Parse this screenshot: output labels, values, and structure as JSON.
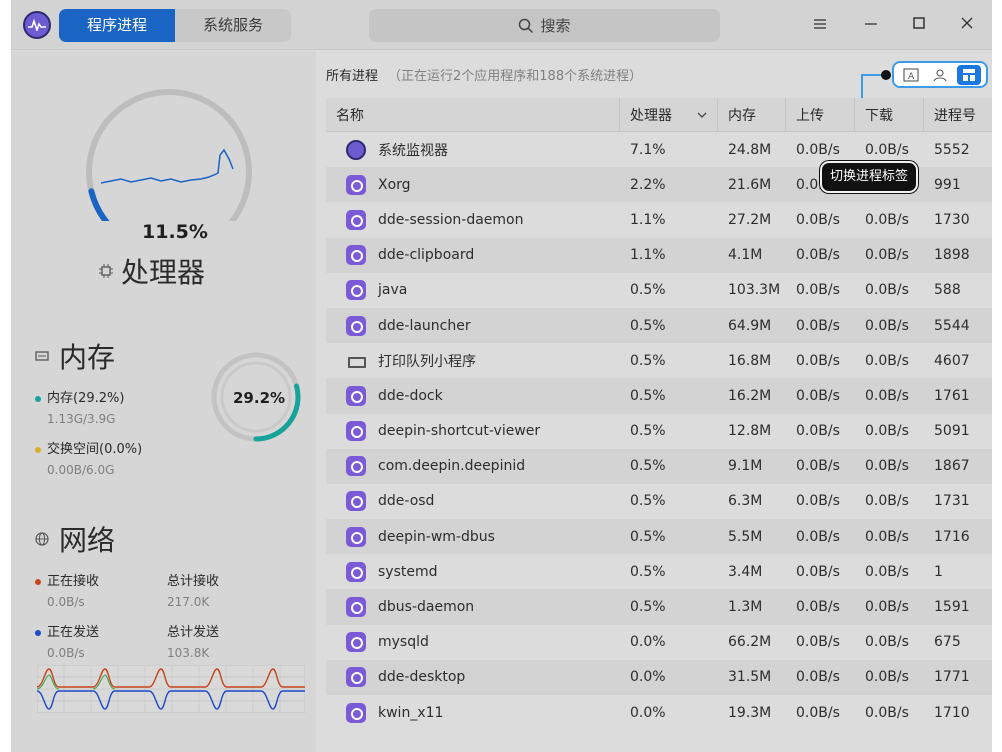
{
  "titlebar": {
    "tabs": [
      {
        "label": "程序进程",
        "active": true
      },
      {
        "label": "系统服务",
        "active": false
      }
    ],
    "search_label": "搜索",
    "icons": [
      "menu-icon",
      "minimize-icon",
      "maximize-icon",
      "close-icon"
    ]
  },
  "cpu": {
    "percent": "11.5%",
    "title": "处理器",
    "gauge_fraction": 0.115
  },
  "memory": {
    "title": "内存",
    "percent": "29.2%",
    "ring_fraction": 0.292,
    "legend": [
      {
        "label": "内存(29.2%)",
        "detail": "1.13G/3.9G",
        "color": "#16a39a"
      },
      {
        "label": "交换空间(0.0%)",
        "detail": "0.00B/6.0G",
        "color": "#d7b02a"
      }
    ]
  },
  "network": {
    "title": "网络",
    "items": [
      {
        "label": "正在接收",
        "value": "0.0B/s",
        "color": "#c8441c"
      },
      {
        "label": "总计接收",
        "value": "217.0K"
      },
      {
        "label": "正在发送",
        "value": "0.0B/s",
        "color": "#1c49c8"
      },
      {
        "label": "总计发送",
        "value": "103.8K"
      }
    ]
  },
  "processes": {
    "header": "所有进程",
    "subheader": "（正在运行2个应用程序和188个系统进程）",
    "tooltip": "切换进程标签",
    "view_buttons": [
      "app-view-icon",
      "user-view-icon",
      "all-view-icon"
    ],
    "columns": [
      "名称",
      "处理器",
      "内存",
      "上传",
      "下载",
      "进程号"
    ],
    "rows": [
      {
        "icon": "monitor",
        "name": "系统监视器",
        "cpu": "7.1%",
        "mem": "24.8M",
        "up": "0.0B/s",
        "down": "0.0B/s",
        "pid": "5552"
      },
      {
        "icon": "app",
        "name": "Xorg",
        "cpu": "2.2%",
        "mem": "21.6M",
        "up": "0.0B/s",
        "down": "0.0B/s",
        "pid": "991"
      },
      {
        "icon": "app",
        "name": "dde-session-daemon",
        "cpu": "1.1%",
        "mem": "27.2M",
        "up": "0.0B/s",
        "down": "0.0B/s",
        "pid": "1730"
      },
      {
        "icon": "app",
        "name": "dde-clipboard",
        "cpu": "1.1%",
        "mem": "4.1M",
        "up": "0.0B/s",
        "down": "0.0B/s",
        "pid": "1898"
      },
      {
        "icon": "app",
        "name": "java",
        "cpu": "0.5%",
        "mem": "103.3M",
        "up": "0.0B/s",
        "down": "0.0B/s",
        "pid": "588"
      },
      {
        "icon": "app",
        "name": "dde-launcher",
        "cpu": "0.5%",
        "mem": "64.9M",
        "up": "0.0B/s",
        "down": "0.0B/s",
        "pid": "5544"
      },
      {
        "icon": "printer",
        "name": "打印队列小程序",
        "cpu": "0.5%",
        "mem": "16.8M",
        "up": "0.0B/s",
        "down": "0.0B/s",
        "pid": "4607"
      },
      {
        "icon": "app",
        "name": "dde-dock",
        "cpu": "0.5%",
        "mem": "16.2M",
        "up": "0.0B/s",
        "down": "0.0B/s",
        "pid": "1761"
      },
      {
        "icon": "app",
        "name": "deepin-shortcut-viewer",
        "cpu": "0.5%",
        "mem": "12.8M",
        "up": "0.0B/s",
        "down": "0.0B/s",
        "pid": "5091"
      },
      {
        "icon": "app",
        "name": "com.deepin.deepinid",
        "cpu": "0.5%",
        "mem": "9.1M",
        "up": "0.0B/s",
        "down": "0.0B/s",
        "pid": "1867"
      },
      {
        "icon": "app",
        "name": "dde-osd",
        "cpu": "0.5%",
        "mem": "6.3M",
        "up": "0.0B/s",
        "down": "0.0B/s",
        "pid": "1731"
      },
      {
        "icon": "app",
        "name": "deepin-wm-dbus",
        "cpu": "0.5%",
        "mem": "5.5M",
        "up": "0.0B/s",
        "down": "0.0B/s",
        "pid": "1716"
      },
      {
        "icon": "app",
        "name": "systemd",
        "cpu": "0.5%",
        "mem": "3.4M",
        "up": "0.0B/s",
        "down": "0.0B/s",
        "pid": "1"
      },
      {
        "icon": "app",
        "name": "dbus-daemon",
        "cpu": "0.5%",
        "mem": "1.3M",
        "up": "0.0B/s",
        "down": "0.0B/s",
        "pid": "1591"
      },
      {
        "icon": "app",
        "name": "mysqld",
        "cpu": "0.0%",
        "mem": "66.2M",
        "up": "0.0B/s",
        "down": "0.0B/s",
        "pid": "675"
      },
      {
        "icon": "app",
        "name": "dde-desktop",
        "cpu": "0.0%",
        "mem": "31.5M",
        "up": "0.0B/s",
        "down": "0.0B/s",
        "pid": "1771"
      },
      {
        "icon": "app",
        "name": "kwin_x11",
        "cpu": "0.0%",
        "mem": "19.3M",
        "up": "0.0B/s",
        "down": "0.0B/s",
        "pid": "1710"
      }
    ]
  }
}
